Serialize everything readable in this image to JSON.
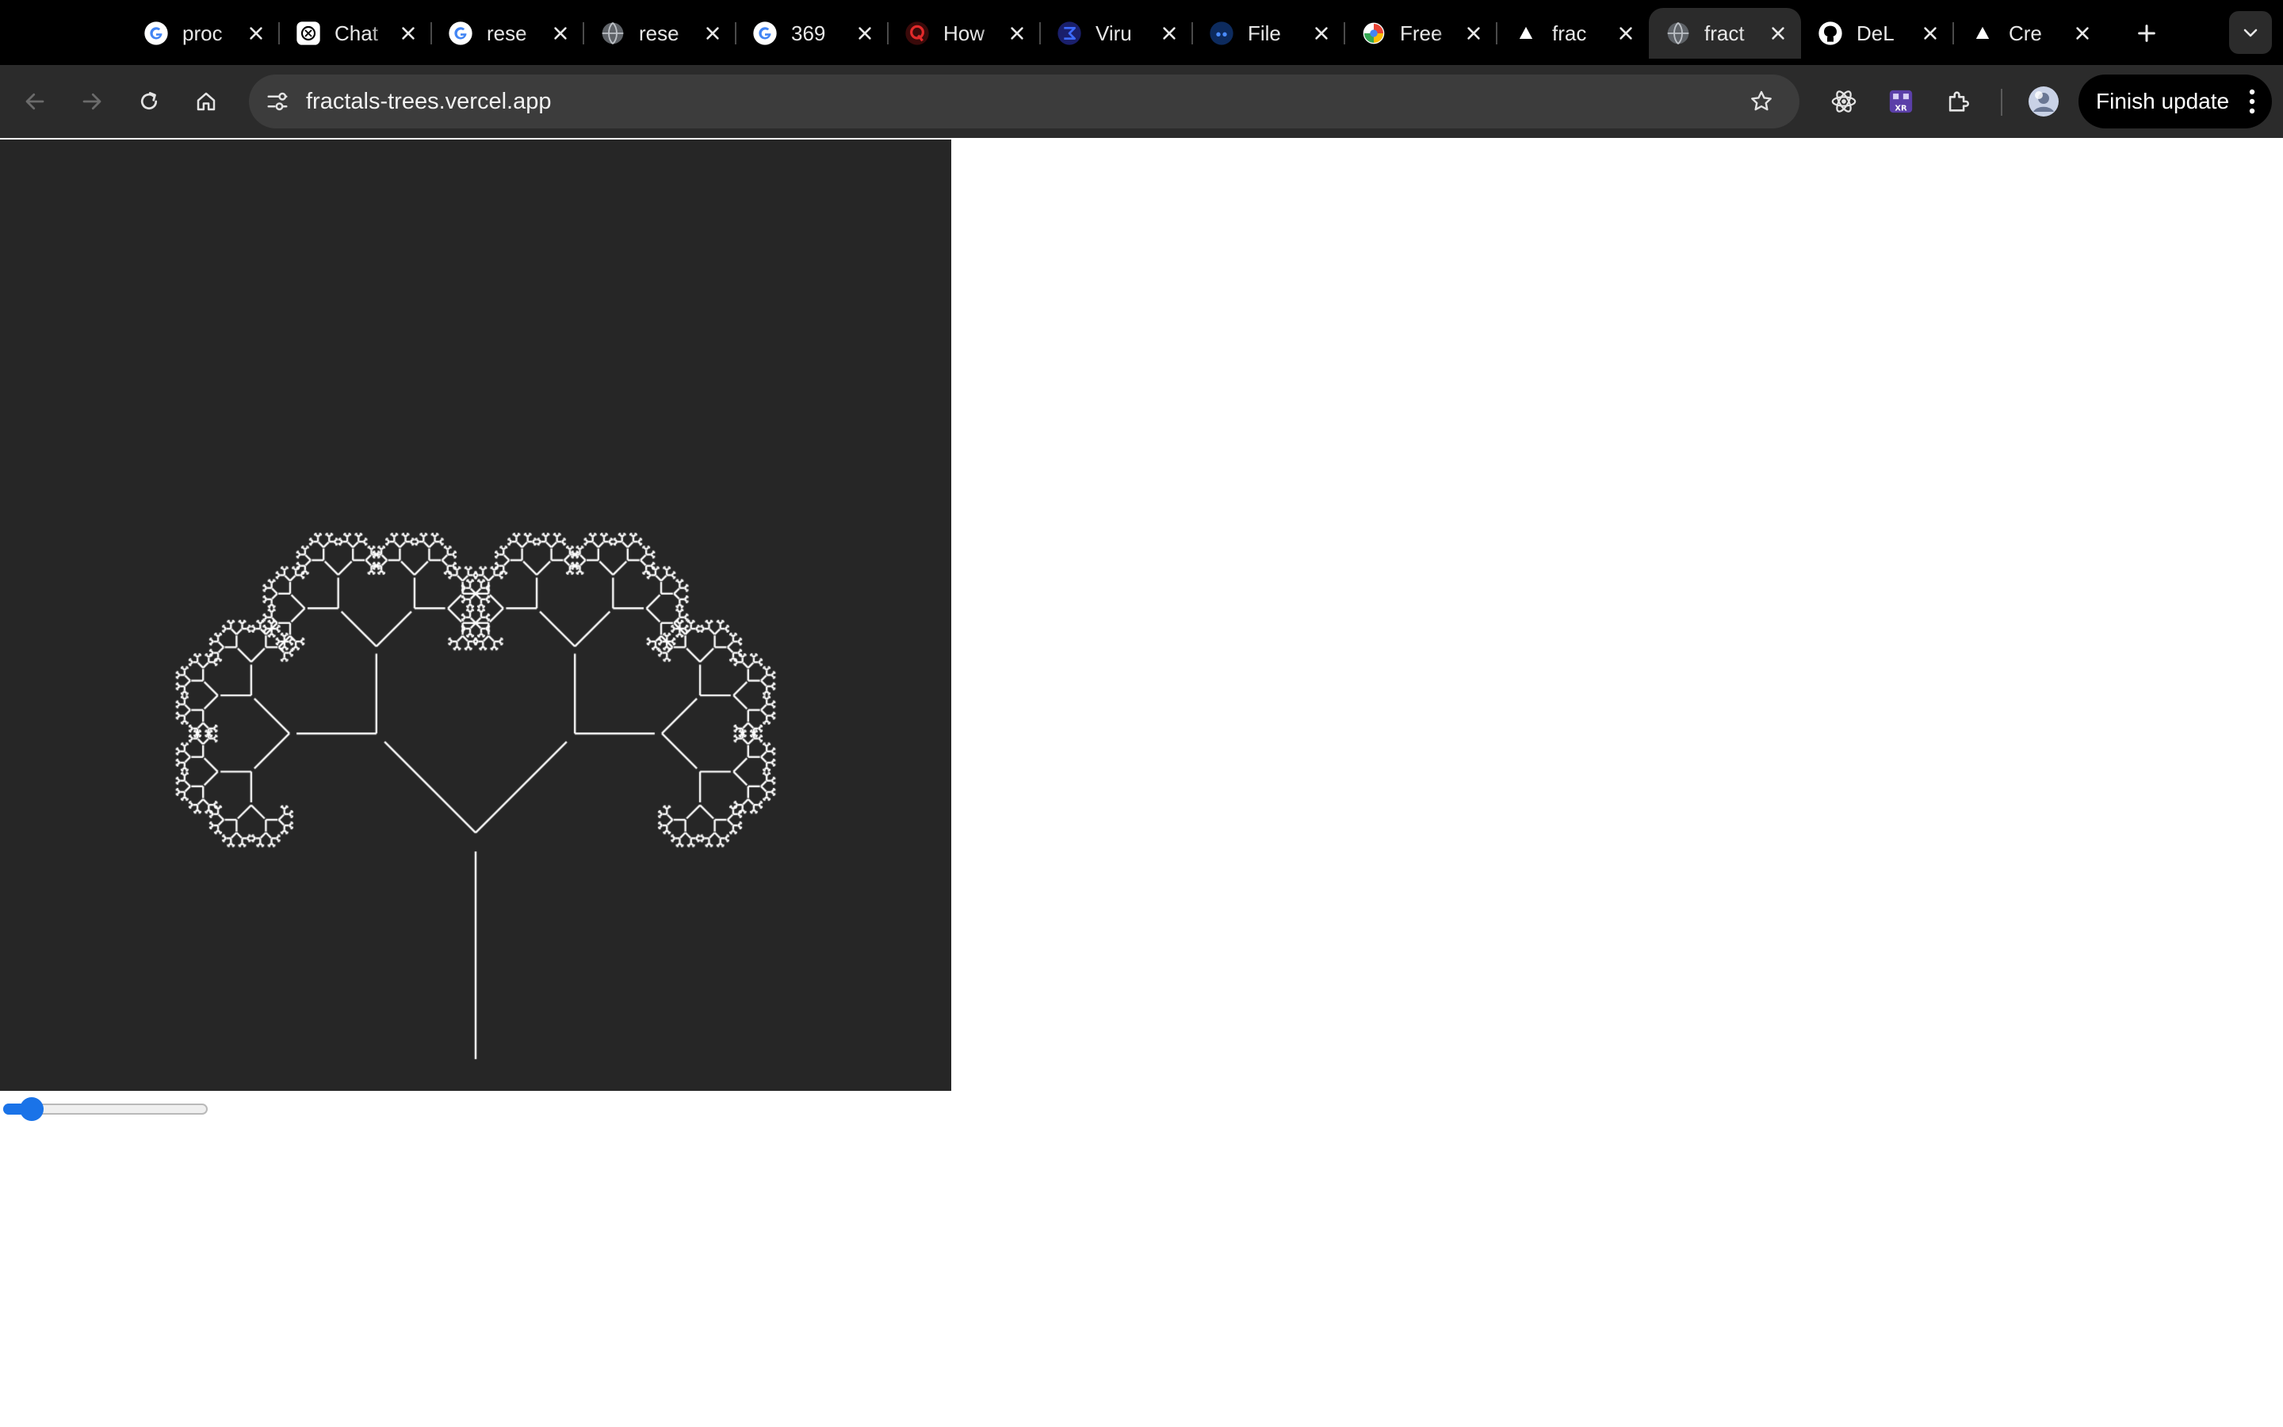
{
  "browser": {
    "tabs": [
      {
        "title": "proc",
        "icon": "google-icon",
        "active": false
      },
      {
        "title": "Chat",
        "icon": "chatgpt-icon",
        "active": false
      },
      {
        "title": "rese",
        "icon": "google-icon",
        "active": false
      },
      {
        "title": "rese",
        "icon": "globe-icon",
        "active": false
      },
      {
        "title": "369",
        "icon": "google-icon",
        "active": false
      },
      {
        "title": "How",
        "icon": "quora-icon",
        "active": false
      },
      {
        "title": "Viru",
        "icon": "virustotal-icon",
        "active": false
      },
      {
        "title": "File",
        "icon": "file-converter-icon",
        "active": false
      },
      {
        "title": "Free",
        "icon": "colorful-swirl-icon",
        "active": false
      },
      {
        "title": "frac",
        "icon": "vercel-icon",
        "active": false
      },
      {
        "title": "fract",
        "icon": "globe-icon",
        "active": true
      },
      {
        "title": "DeL",
        "icon": "github-icon",
        "active": false
      },
      {
        "title": "Cre",
        "icon": "vercel-icon",
        "active": false
      }
    ],
    "address_bar": {
      "url": "fractals-trees.vercel.app"
    },
    "finish_update_label": "Finish update"
  },
  "page": {
    "canvas_background": "#262626",
    "stroke_color": "#ffffff",
    "slider": {
      "value_fraction": 0.09,
      "accent": "#1a73e8"
    }
  }
}
